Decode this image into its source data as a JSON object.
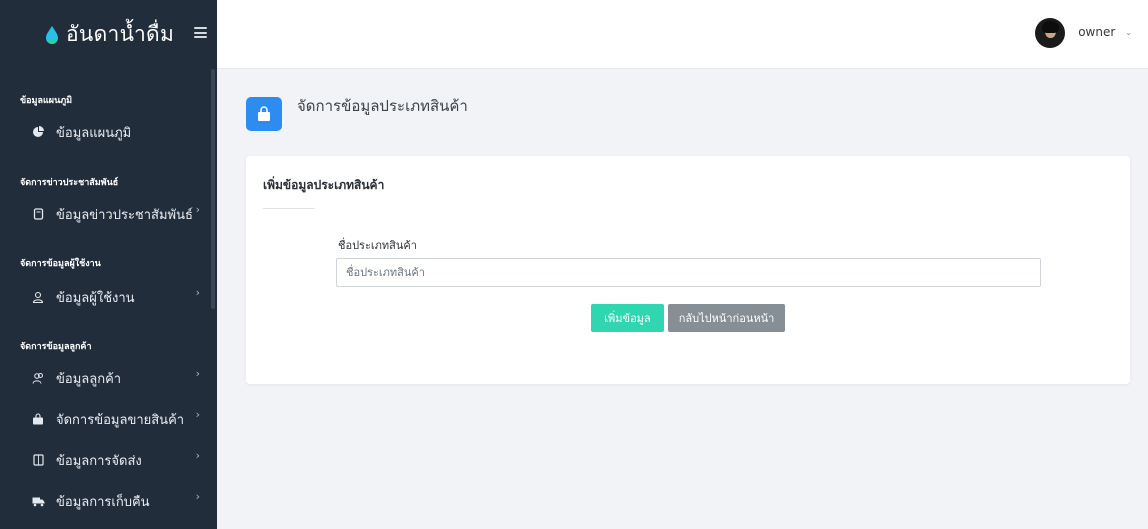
{
  "brand": {
    "name": "อันดาน้ำดื่ม",
    "accent": "#2d8cf0"
  },
  "user": {
    "name": "owner"
  },
  "sidebar": {
    "sections": [
      {
        "title": "ข้อมูลแผนภูมิ"
      },
      {
        "title": "จัดการข่าวประชาสัมพันธ์"
      },
      {
        "title": "จัดการข้อมูลผู้ใช้งาน"
      },
      {
        "title": "จัดการข้อมูลลูกค้า"
      }
    ],
    "items": [
      {
        "label": "ข้อมูลแผนภูมิ",
        "icon": "pie-chart-icon"
      },
      {
        "label": "ข้อมูลข่าวประชาสัมพันธ์",
        "icon": "document-icon"
      },
      {
        "label": "ข้อมูลผู้ใช้งาน",
        "icon": "user-icon"
      },
      {
        "label": "ข้อมูลลูกค้า",
        "icon": "users-icon"
      },
      {
        "label": "จัดการข้อมูลขายสินค้า",
        "icon": "shopping-bag-icon"
      },
      {
        "label": "ข้อมูลการจัดส่ง",
        "icon": "box-icon"
      },
      {
        "label": "ข้อมูลการเก็บคืน",
        "icon": "truck-icon"
      }
    ]
  },
  "page": {
    "title": "จัดการข้อมูลประเภทสินค้า"
  },
  "form": {
    "heading": "เพิ่มข้อมูลประเภทสินค้า",
    "field_label": "ชื่อประเภทสินค้า",
    "field_placeholder": "ชื่อประเภทสินค้า",
    "field_value": "",
    "submit_label": "เพิ่มข้อมูล",
    "back_label": "กลับไปหน้าก่อนหน้า"
  }
}
